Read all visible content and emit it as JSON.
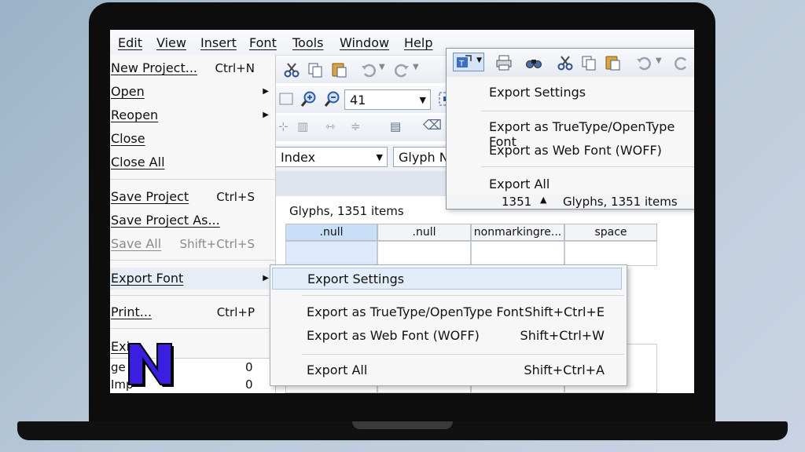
{
  "menubar": {
    "items": [
      "Edit",
      "View",
      "Insert",
      "Font",
      "Tools",
      "Window",
      "Help"
    ]
  },
  "file_menu": {
    "items": [
      {
        "label": "New Project...",
        "shortcut": "Ctrl+N",
        "submenu": false,
        "disabled": false
      },
      {
        "label": "Open",
        "shortcut": "",
        "submenu": true,
        "disabled": false
      },
      {
        "label": "Reopen",
        "shortcut": "",
        "submenu": true,
        "disabled": false
      },
      {
        "label": "Close",
        "shortcut": "",
        "submenu": false,
        "disabled": false
      },
      {
        "label": "Close All",
        "shortcut": "",
        "submenu": false,
        "disabled": false
      },
      {
        "label": "Save Project",
        "shortcut": "Ctrl+S",
        "submenu": false,
        "disabled": false
      },
      {
        "label": "Save Project As...",
        "shortcut": "",
        "submenu": false,
        "disabled": false
      },
      {
        "label": "Save All",
        "shortcut": "Shift+Ctrl+S",
        "submenu": false,
        "disabled": true
      },
      {
        "label": "Export Font",
        "shortcut": "",
        "submenu": true,
        "disabled": false
      },
      {
        "label": "Print...",
        "shortcut": "Ctrl+P",
        "submenu": false,
        "disabled": false
      },
      {
        "label": "Exi",
        "shortcut": "",
        "submenu": false,
        "disabled": false
      }
    ],
    "partial_rows": [
      {
        "label": "ge",
        "value": "0"
      },
      {
        "label": "Imp",
        "value": "0"
      }
    ]
  },
  "export_submenu": {
    "items": [
      {
        "label": "Export Settings",
        "shortcut": ""
      },
      {
        "label": "Export as TrueType/OpenType Font",
        "shortcut": "Shift+Ctrl+E"
      },
      {
        "label": "Export as Web Font (WOFF)",
        "shortcut": "Shift+Ctrl+W"
      },
      {
        "label": "Export All",
        "shortcut": "Shift+Ctrl+A"
      }
    ]
  },
  "toolbar": {
    "zoom_value": "41",
    "index_combo": "Index",
    "glyph_name_combo": "Glyph Na"
  },
  "glyph_panel": {
    "title": "Glyphs, 1351 items",
    "columns": [
      ".null",
      ".null",
      "nonmarkingre...",
      "space"
    ]
  },
  "popup": {
    "items": [
      "Export Settings",
      "Export as TrueType/OpenType Font",
      "Export as Web Font (WOFF)",
      "Export All"
    ],
    "count": "1351",
    "status": "Glyphs, 1351 items"
  },
  "logo_letter": "N"
}
